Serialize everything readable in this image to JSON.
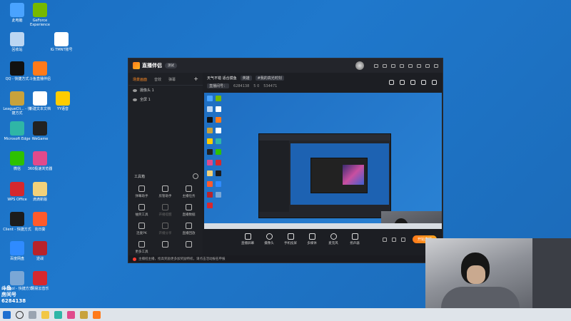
{
  "desktop": {
    "icons": [
      {
        "label": "此电脑",
        "icon": "computer-icon",
        "color": "#4aa3ff"
      },
      {
        "label": "GeForce Experience",
        "icon": "nvidia-icon",
        "color": "#76b900"
      },
      {
        "label": "回收站",
        "icon": "recycle-bin-icon",
        "color": "#bcd6f2"
      },
      {
        "label": "IG TMNT账号",
        "icon": "document-icon",
        "color": "#ffffff"
      },
      {
        "label": "QQ - 快捷方式",
        "icon": "qq-icon",
        "color": "#111111"
      },
      {
        "label": "斗鱼直播伴侣",
        "icon": "douyu-icon",
        "color": "#ff7a1a"
      },
      {
        "label": "LeagueCli... - 快捷方式",
        "icon": "league-icon",
        "color": "#c8a23c"
      },
      {
        "label": "新建文本文档",
        "icon": "text-file-icon",
        "color": "#ffffff"
      },
      {
        "label": "YY语音",
        "icon": "yy-icon",
        "color": "#ffcc00"
      },
      {
        "label": "Microsoft Edge",
        "icon": "edge-icon",
        "color": "#2fb6a6"
      },
      {
        "label": "WeGame",
        "icon": "wegame-icon",
        "color": "#222222"
      },
      {
        "label": "微信",
        "icon": "wechat-icon",
        "color": "#2dc100"
      },
      {
        "label": "360极速浏览器",
        "icon": "browser-360-icon",
        "color": "#e04a8c"
      },
      {
        "label": "WPS Office",
        "icon": "wps-icon",
        "color": "#d4282d"
      },
      {
        "label": "滴滴新版",
        "icon": "file-icon",
        "color": "#f2d17a"
      },
      {
        "label": "Client - 快捷方式",
        "icon": "client-icon",
        "color": "#1c1c1c"
      },
      {
        "label": "向日葵",
        "icon": "sunlogin-icon",
        "color": "#ff5a2b"
      },
      {
        "label": "百度网盘",
        "icon": "baidu-netdisk-icon",
        "color": "#2f8bff"
      },
      {
        "label": "逆战",
        "icon": "nizhan-icon",
        "color": "#b8232b"
      },
      {
        "label": "tclsTool - 快捷方式",
        "icon": "tool-icon",
        "color": "#7aa7d6"
      },
      {
        "label": "网易云音乐",
        "icon": "netease-music-icon",
        "color": "#d6282f"
      }
    ],
    "room_badge": {
      "brand": "斗鱼",
      "label": "房间号",
      "number": "6284138"
    }
  },
  "taskbar": {
    "items": [
      "start-icon",
      "search-icon",
      "task-view-icon",
      "file-explorer-icon",
      "edge-icon",
      "browser-360-icon",
      "league-icon",
      "douyu-icon"
    ]
  },
  "app": {
    "title": "直播伴侣",
    "version_pill": "测试",
    "tabs": [
      "场景画面",
      "音效",
      "弹幕"
    ],
    "active_tab": 0,
    "sources": [
      "摄像头 1",
      "全屏 1"
    ],
    "tools_title": "工具箱",
    "tools": [
      {
        "label": "弹幕助手",
        "dim": false
      },
      {
        "label": "房管助手",
        "dim": false
      },
      {
        "label": "主播任务",
        "dim": false
      },
      {
        "label": "抽奖工具",
        "dim": false
      },
      {
        "label": "开播提醒",
        "dim": true
      },
      {
        "label": "直播数据",
        "dim": false
      },
      {
        "label": "连麦PK",
        "dim": false
      },
      {
        "label": "开播分享",
        "dim": true
      },
      {
        "label": "直播回放",
        "dim": false
      },
      {
        "label": "更多工具",
        "dim": false
      },
      {
        "label": "",
        "dim": false
      },
      {
        "label": "",
        "dim": false
      }
    ],
    "room": {
      "title": "天气不错 适合摸鱼",
      "category": "英雄",
      "tag": "#我的高光时刻",
      "room_id_label": "直播间号：",
      "room_id": "6284138",
      "viewers": "5 0",
      "hot": "534471"
    },
    "bottom_tools": [
      "直播屏幕",
      "摄像头",
      "手机投屏",
      "多媒体",
      "麦克风",
      "扬声器"
    ],
    "go_live": "开始直播",
    "status_text": "主播招主播，抢高奖励更多加奖励特权，请点击活动报名申报"
  },
  "colors": {
    "accent": "#ff8a24",
    "desktop": "#1f73c4",
    "panel": "#1c1e23"
  }
}
